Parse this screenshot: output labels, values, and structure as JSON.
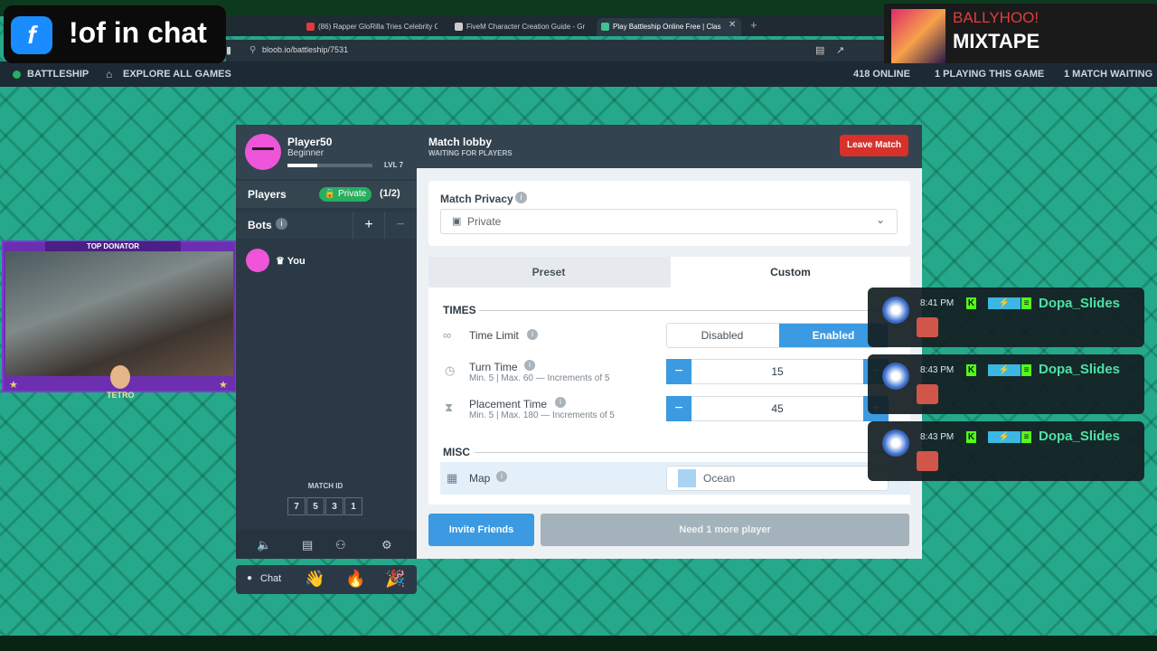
{
  "overlay": {
    "logo_text": "!of in chat",
    "mixtape_top": "BALLYHOO!",
    "mixtape_bottom": "MIXTAPE",
    "cam_label": "TOP DONATOR",
    "cam_name": "TETRO"
  },
  "browser": {
    "tabs": [
      {
        "label": "(86) Rapper GloRilla Tries Celebrity G",
        "color": "#e03b3b"
      },
      {
        "label": "FiveM Character Creation Guide - Gr",
        "color": "#cccccc"
      },
      {
        "label": "Play Battleship Online Free | Clas",
        "color": "#3ec48c"
      }
    ],
    "url": "bloob.io/battleship/7531"
  },
  "nav": {
    "game": "BATTLESHIP",
    "explore": "EXPLORE ALL GAMES",
    "online": "418 ONLINE",
    "playing": "1 PLAYING THIS GAME",
    "waiting": "1 MATCH WAITING"
  },
  "player": {
    "name": "Player50",
    "rank": "Beginner",
    "level": "LVL 7",
    "xp_fraction": 0.35
  },
  "players": {
    "label": "Players",
    "privacy": "🔒 Private",
    "count": "(1/2)"
  },
  "bots": {
    "label": "Bots",
    "add": "+",
    "remove": "−"
  },
  "you": "♛ You",
  "match_id": {
    "label": "MATCH ID",
    "digits": [
      "7",
      "5",
      "3",
      "1"
    ]
  },
  "chat": {
    "label": "Chat",
    "emotes": [
      "👋",
      "🔥",
      "🎉"
    ]
  },
  "lobby": {
    "title": "Match lobby",
    "subtitle": "WAITING FOR PLAYERS",
    "leave": "Leave Match"
  },
  "privacy": {
    "label": "Match Privacy",
    "value": "Private"
  },
  "tabs": {
    "preset": "Preset",
    "custom": "Custom"
  },
  "times": {
    "section": "TIMES",
    "time_limit": {
      "label": "Time Limit",
      "disabled": "Disabled",
      "enabled": "Enabled"
    },
    "turn": {
      "label": "Turn Time",
      "sub": "Min. 5 | Max. 60 — Increments of 5",
      "value": "15"
    },
    "placement": {
      "label": "Placement Time",
      "sub": "Min. 5 | Max. 180 — Increments of 5",
      "value": "45"
    }
  },
  "misc": {
    "section": "MISC",
    "map_label": "Map",
    "map_value": "Ocean"
  },
  "actions": {
    "invite": "Invite Friends",
    "need": "Need 1 more player"
  },
  "stream_chat": [
    {
      "time": "8:41 PM",
      "user": "Dopa_Slides"
    },
    {
      "time": "8:43 PM",
      "user": "Dopa_Slides"
    },
    {
      "time": "8:43 PM",
      "user": "Dopa_Slides"
    }
  ],
  "colors": {
    "accent": "#3b9ae1",
    "danger": "#d6322b",
    "success": "#27ae60",
    "avatar": "#ee55d8"
  }
}
